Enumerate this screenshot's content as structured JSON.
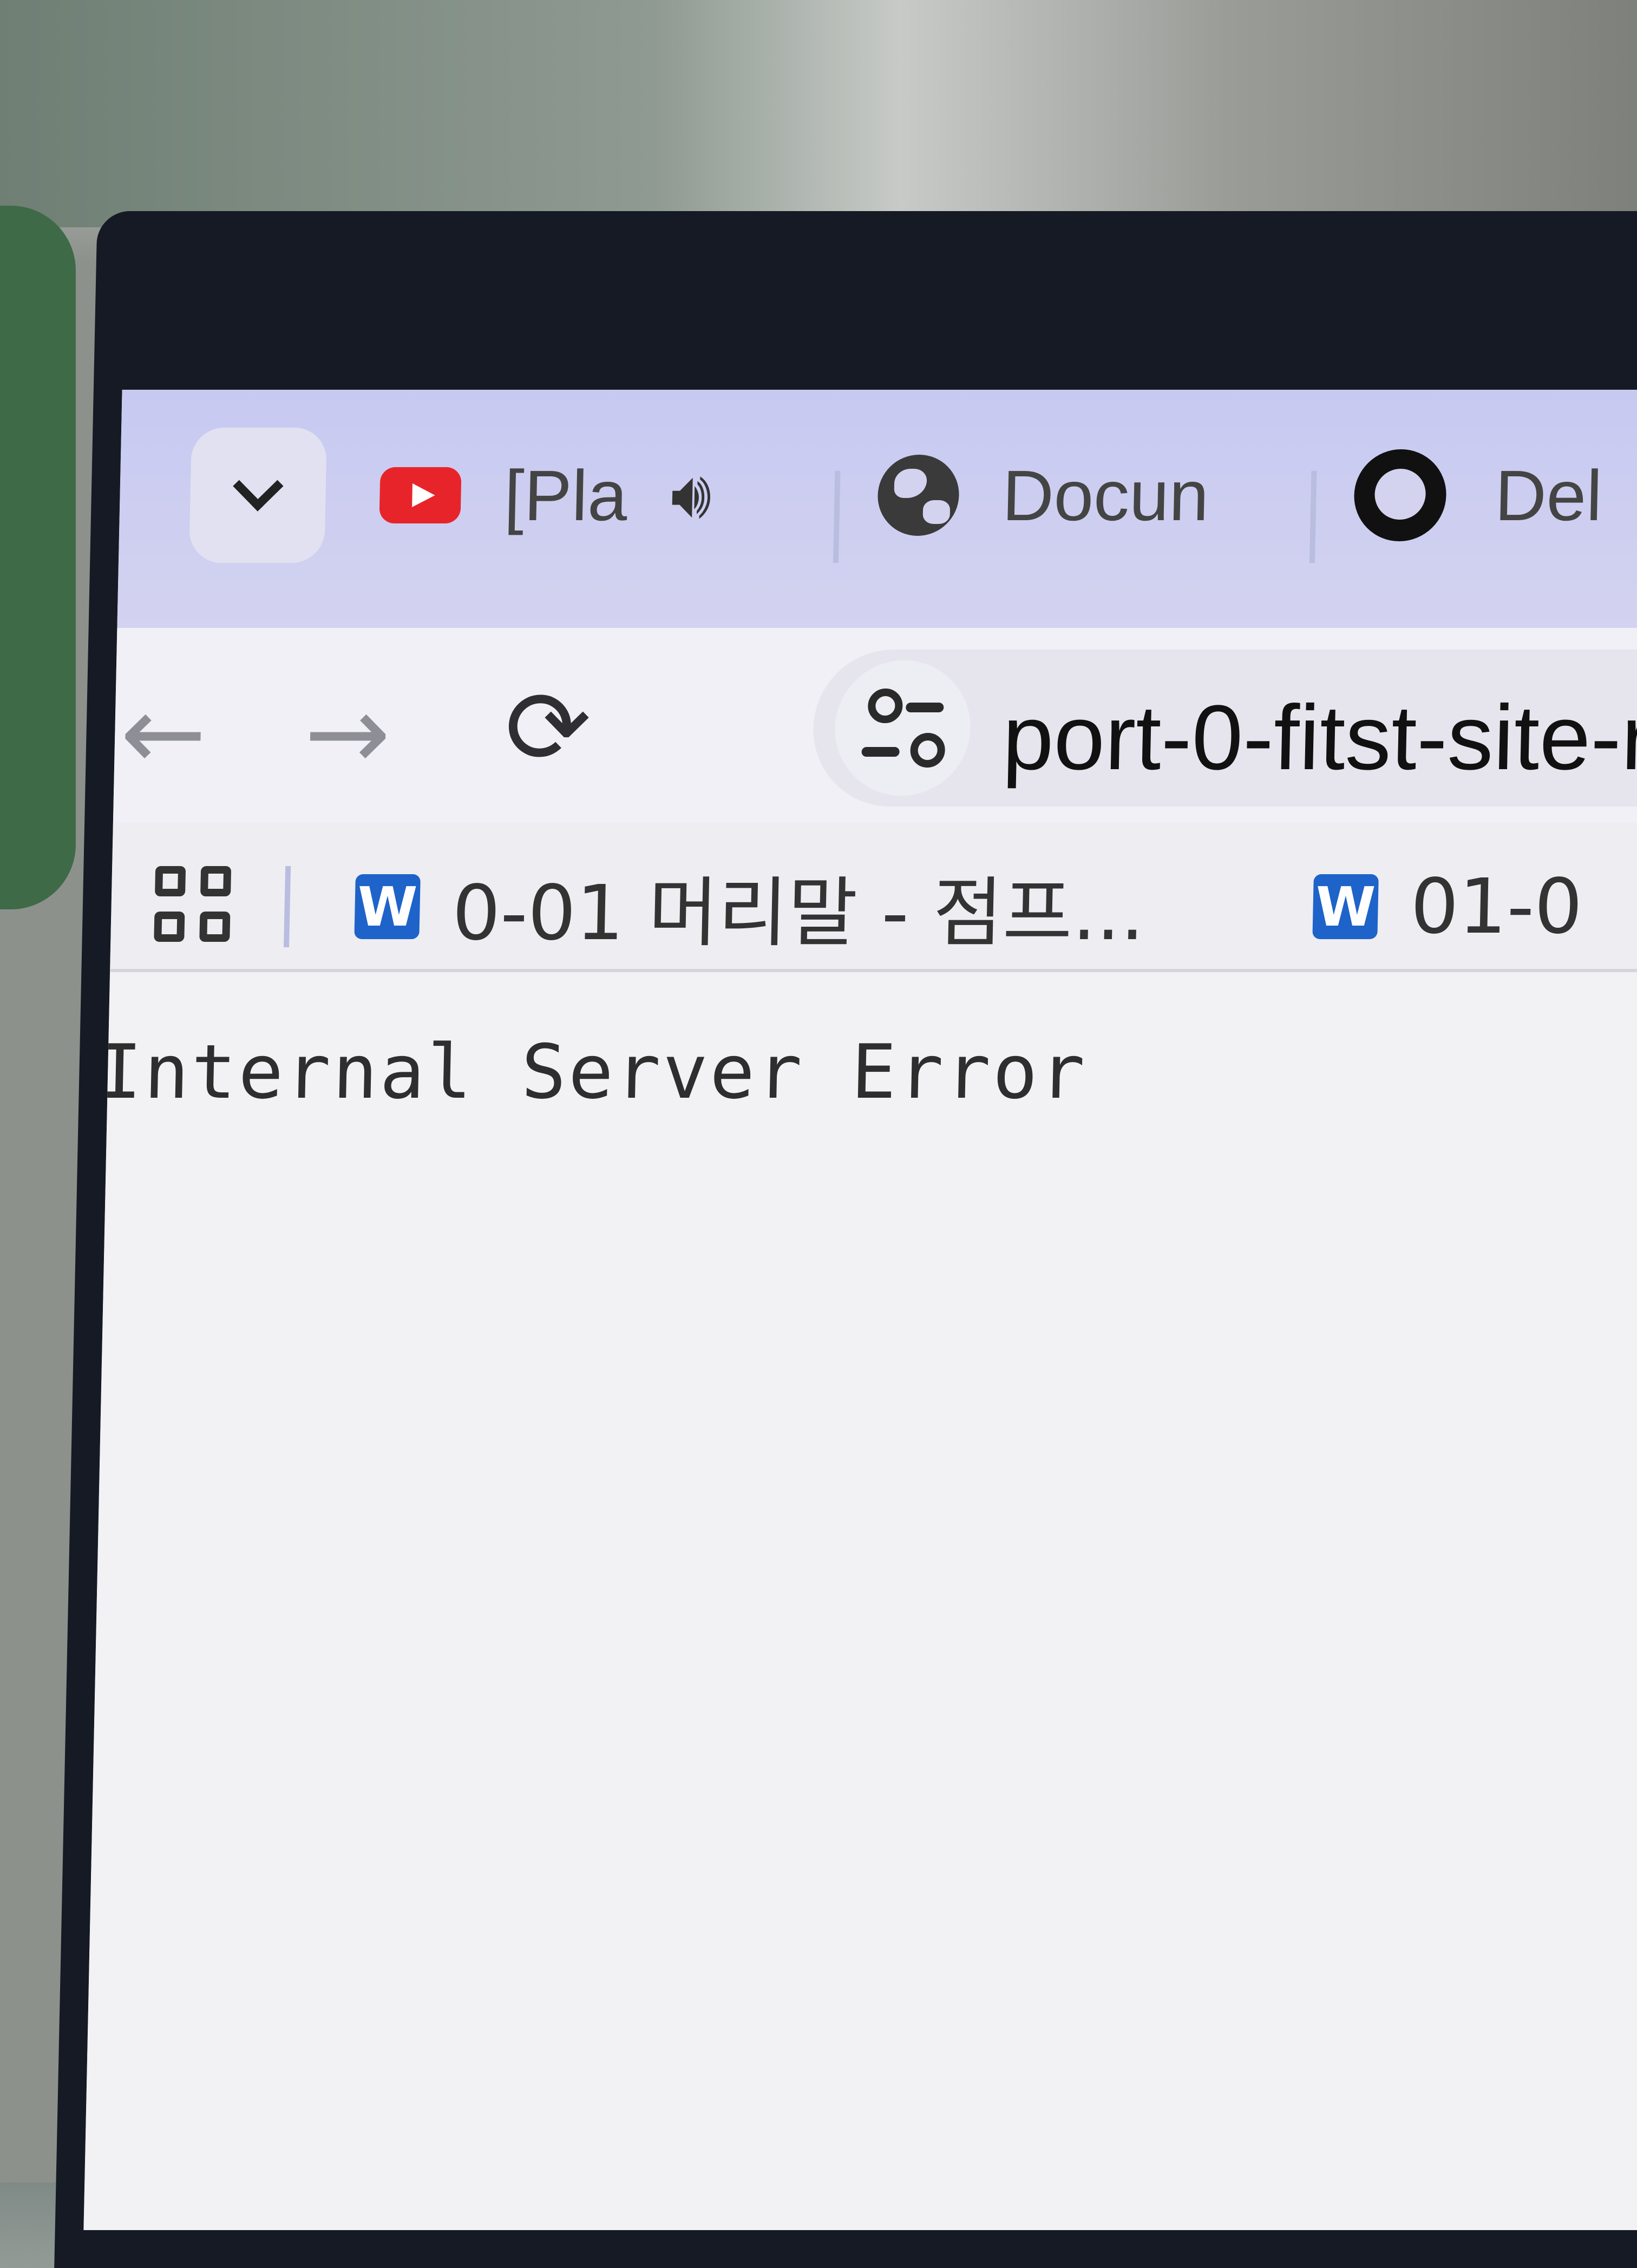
{
  "tabs": [
    {
      "label": "[Pla",
      "icon": "youtube-icon"
    },
    {
      "label": "Docun",
      "icon": "globe-icon"
    },
    {
      "label": "Del",
      "icon": "github-icon"
    }
  ],
  "toolbar": {
    "back_icon": "←",
    "forward_icon": "→",
    "reload_icon": "⟳",
    "url": "port-0-fitst-site-r"
  },
  "bookmarks": [
    {
      "label": "0-01 머리말 - 점프...",
      "icon_text": "W"
    },
    {
      "label": "01-0",
      "icon_text": "W"
    }
  ],
  "page": {
    "message": "Internal Server Error"
  }
}
